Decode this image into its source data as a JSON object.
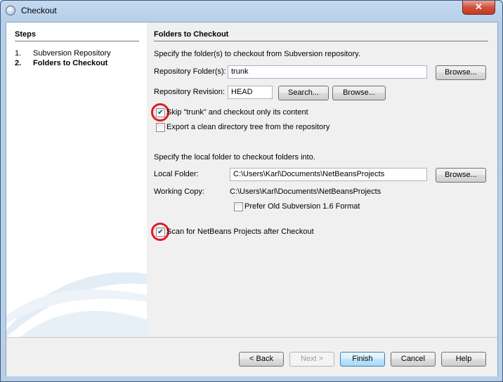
{
  "window": {
    "title": "Checkout",
    "close_label": "✕"
  },
  "steps": {
    "title": "Steps",
    "items": [
      {
        "num": "1.",
        "label": "Subversion Repository"
      },
      {
        "num": "2.",
        "label": "Folders to Checkout"
      }
    ]
  },
  "main": {
    "heading": "Folders to Checkout",
    "intro": "Specify the folder(s) to checkout from Subversion repository.",
    "repo_folder_label": "Repository Folder(s):",
    "repo_folder_value": "trunk",
    "browse_label": "Browse...",
    "revision_label": "Repository Revision:",
    "revision_value": "HEAD",
    "search_label": "Search...",
    "browse2_label": "Browse...",
    "skip_trunk_label": "Skip \"trunk\" and checkout only its content",
    "skip_trunk_checked": true,
    "export_label": "Export a clean directory tree from the repository",
    "export_checked": false,
    "local_intro": "Specify the local folder to checkout folders into.",
    "local_folder_label": "Local Folder:",
    "local_folder_value": "C:\\Users\\Karl\\Documents\\NetBeansProjects",
    "browse3_label": "Browse...",
    "working_copy_label": "Working Copy:",
    "working_copy_value": "C:\\Users\\Karl\\Documents\\NetBeansProjects",
    "prefer_old_label": "Prefer Old Subversion 1.6 Format",
    "prefer_old_checked": false,
    "scan_label": "Scan for NetBeans Projects after Checkout",
    "scan_checked": true
  },
  "buttons": {
    "back": "< Back",
    "next": "Next >",
    "finish": "Finish",
    "cancel": "Cancel",
    "help": "Help"
  },
  "colors": {
    "annotation_circle": "#e01b24",
    "default_button": "#3c7fb1"
  },
  "icons": {
    "app": "netbeans-app-icon",
    "checked": "checkmark-icon"
  }
}
